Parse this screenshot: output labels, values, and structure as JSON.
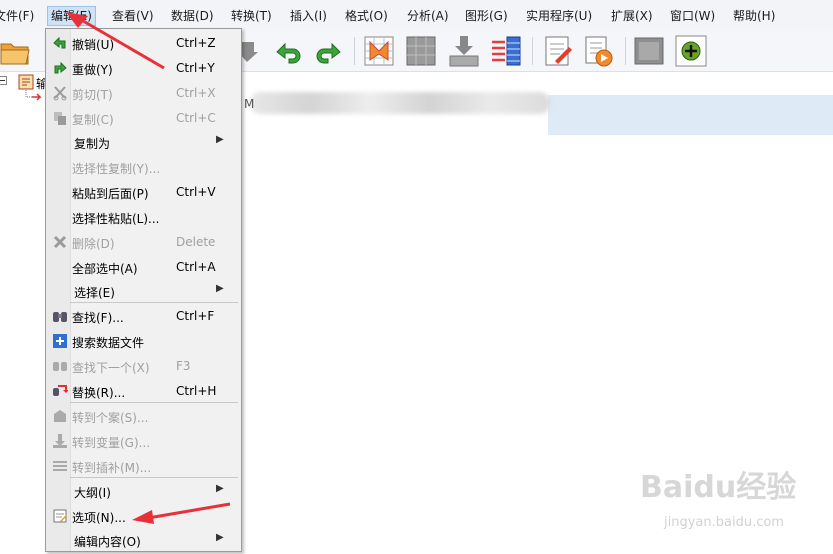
{
  "menubar": {
    "items": [
      {
        "label": "文件(F)"
      },
      {
        "label": "编辑(E)"
      },
      {
        "label": "查看(V)"
      },
      {
        "label": "数据(D)"
      },
      {
        "label": "转换(T)"
      },
      {
        "label": "插入(I)"
      },
      {
        "label": "格式(O)"
      },
      {
        "label": "分析(A)"
      },
      {
        "label": "图形(G)"
      },
      {
        "label": "实用程序(U)"
      },
      {
        "label": "扩展(X)"
      },
      {
        "label": "窗口(W)"
      },
      {
        "label": "帮助(H)"
      }
    ]
  },
  "toolbar": {
    "icons": [
      "open-folder-icon",
      "undo-icon",
      "redo-icon",
      "goto-case-icon",
      "goto-variable-icon",
      "insert-cases-icon",
      "split-file-icon",
      "chart-editor-icon",
      "play-script-icon",
      "gray-box-icon",
      "add-icon"
    ]
  },
  "tree": {
    "root_label": "输",
    "node_label": "M"
  },
  "edit_menu": {
    "items": [
      {
        "label": "撤销(U)",
        "shortcut": "Ctrl+Z",
        "disabled": false,
        "icon": "undo-icon"
      },
      {
        "label": "重做(Y)",
        "shortcut": "Ctrl+Y",
        "disabled": false,
        "icon": "redo-icon"
      },
      {
        "label": "剪切(T)",
        "shortcut": "Ctrl+X",
        "disabled": true,
        "icon": "scissors-icon"
      },
      {
        "label": "复制(C)",
        "shortcut": "Ctrl+C",
        "disabled": true,
        "icon": "copy-icon"
      },
      {
        "label": "复制为",
        "shortcut": "",
        "disabled": false,
        "submenu": true
      },
      {
        "label": "选择性复制(Y)...",
        "shortcut": "",
        "disabled": true
      },
      {
        "label": "粘贴到后面(P)",
        "shortcut": "Ctrl+V",
        "disabled": false
      },
      {
        "label": "选择性粘贴(L)...",
        "shortcut": "",
        "disabled": false
      },
      {
        "label": "删除(D)",
        "shortcut": "Delete",
        "disabled": true,
        "icon": "delete-icon"
      },
      {
        "label": "全部选中(A)",
        "shortcut": "Ctrl+A",
        "disabled": false
      },
      {
        "label": "选择(E)",
        "shortcut": "",
        "disabled": false,
        "submenu": true
      },
      {
        "label": "查找(F)...",
        "shortcut": "Ctrl+F",
        "disabled": false,
        "icon": "binoculars-icon"
      },
      {
        "label": "搜索数据文件",
        "shortcut": "",
        "disabled": false,
        "icon": "plus-search-icon"
      },
      {
        "label": "查找下一个(X)",
        "shortcut": "F3",
        "disabled": true,
        "icon": "find-next-icon"
      },
      {
        "label": "替换(R)...",
        "shortcut": "Ctrl+H",
        "disabled": false,
        "icon": "replace-icon"
      },
      {
        "label": "转到个案(S)...",
        "shortcut": "",
        "disabled": true,
        "icon": "goto-case-icon"
      },
      {
        "label": "转到变量(G)...",
        "shortcut": "",
        "disabled": true,
        "icon": "goto-variable-icon"
      },
      {
        "label": "转到插补(M)...",
        "shortcut": "",
        "disabled": true,
        "icon": "goto-imputation-icon"
      },
      {
        "label": "大纲(I)",
        "shortcut": "",
        "disabled": false,
        "submenu": true
      },
      {
        "label": "选项(N)...",
        "shortcut": "",
        "disabled": false,
        "icon": "options-icon"
      },
      {
        "label": "编辑内容(O)",
        "shortcut": "",
        "disabled": false,
        "submenu": true
      }
    ]
  },
  "watermark": {
    "brand": "Baidu经验",
    "url": "jingyan.baidu.com"
  },
  "colors": {
    "accent_red": "#e8303a",
    "highlight": "#dfeaf7"
  }
}
